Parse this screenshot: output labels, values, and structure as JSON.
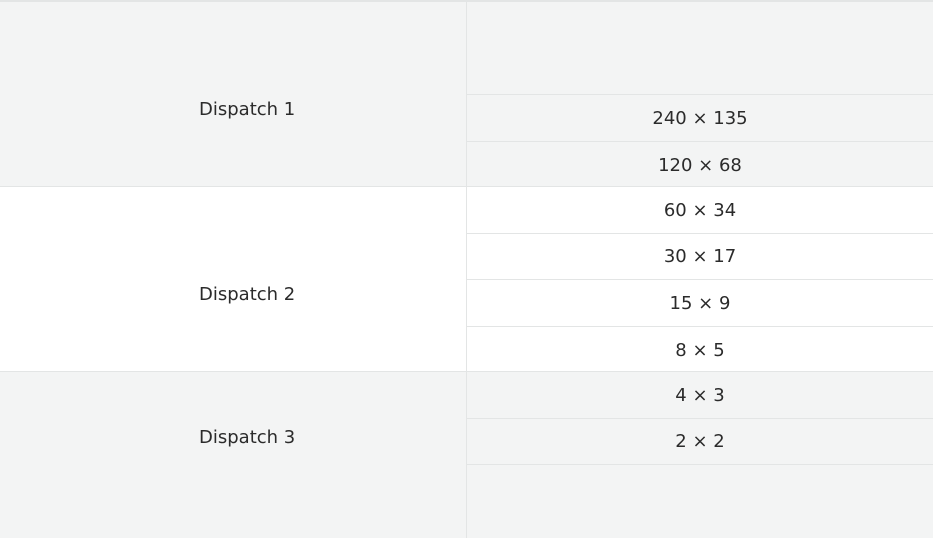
{
  "groups": [
    {
      "label": "Dispatch 1",
      "sizes": [
        "240 × 135",
        "120 × 68"
      ]
    },
    {
      "label": "Dispatch 2",
      "sizes": [
        "60 × 34",
        "30 × 17",
        "15 × 9",
        "8 × 5"
      ]
    },
    {
      "label": "Dispatch 3",
      "sizes": [
        "4 × 3",
        "2 × 2"
      ]
    }
  ],
  "colors": {
    "shaded_row": "#f3f4f4",
    "white_row": "#ffffff",
    "divider": "#e3e5e5",
    "text": "#2b2b2b"
  }
}
